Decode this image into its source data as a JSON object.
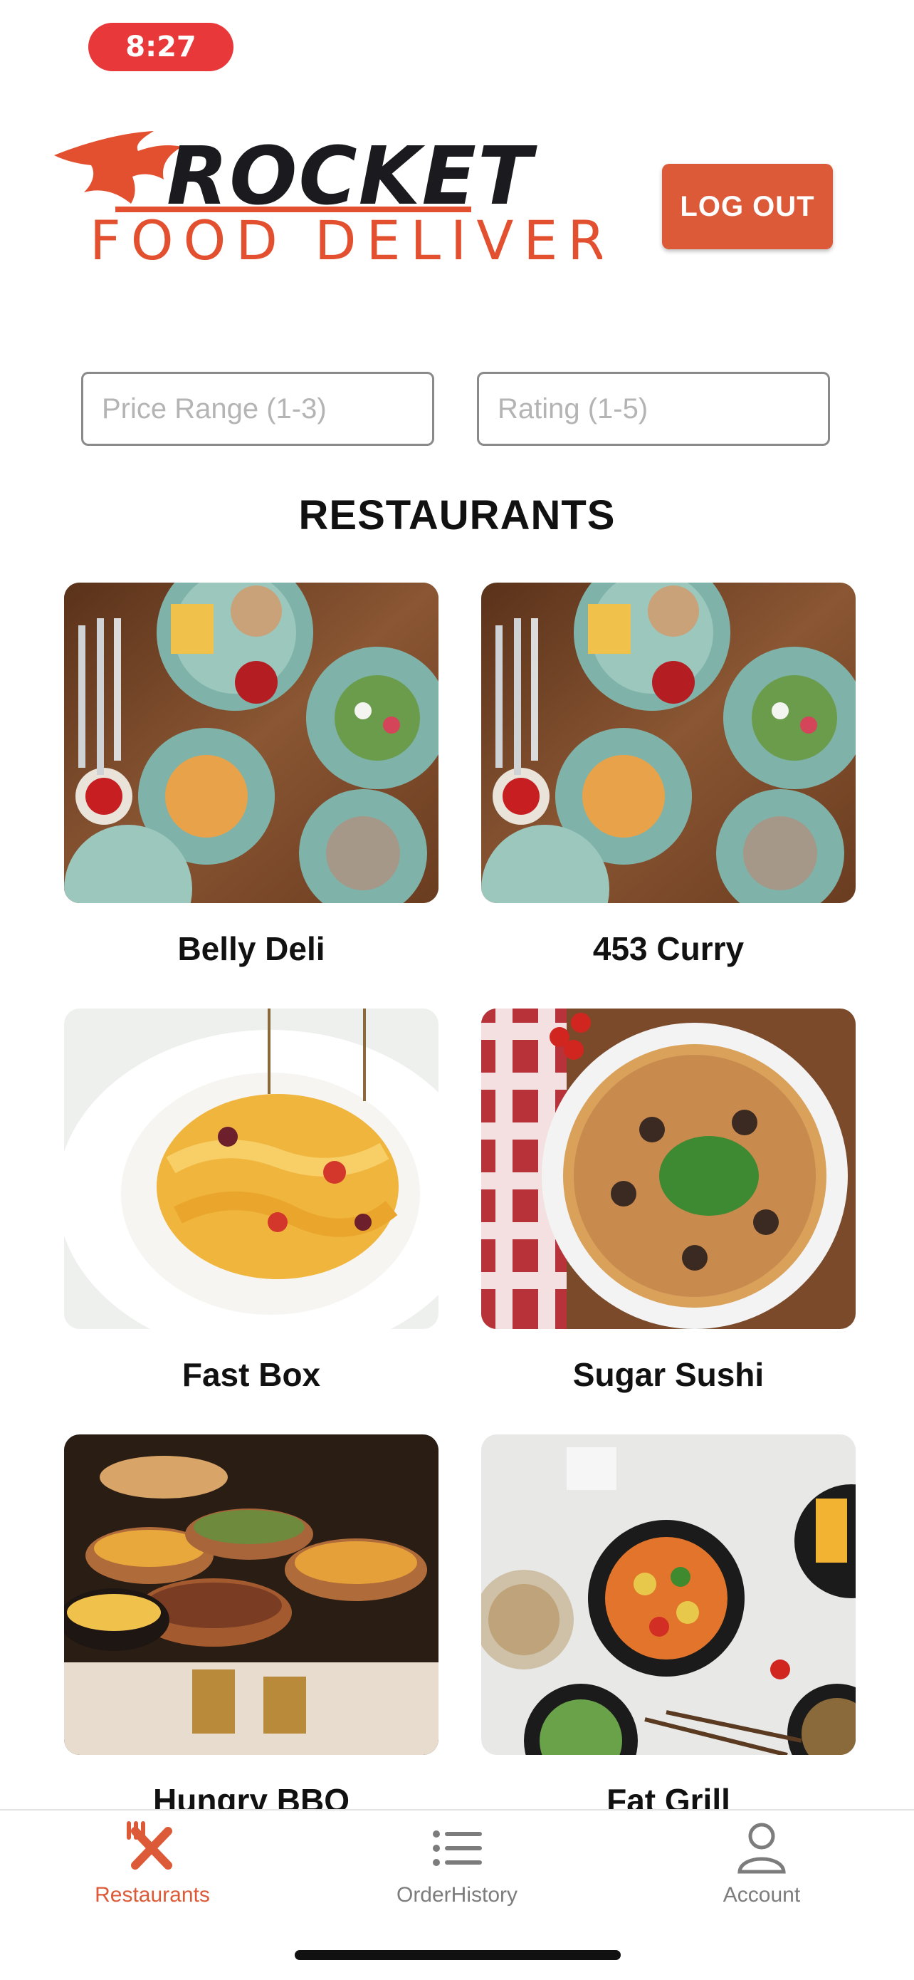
{
  "status_bar": {
    "time": "8:27"
  },
  "header": {
    "logo_word": "ROCKET",
    "logo_tagline": "FOOD DELIVERY",
    "logout_label": "LOG OUT",
    "brand_color": "#dd5a39"
  },
  "filters": {
    "price_placeholder": "Price Range (1-3)",
    "rating_placeholder": "Rating (1-5)"
  },
  "section_title": "RESTAURANTS",
  "restaurants": [
    {
      "name": "Belly Deli",
      "image": "table-spread-photo"
    },
    {
      "name": "453 Curry",
      "image": "table-spread-photo"
    },
    {
      "name": "Fast Box",
      "image": "pasta-photo"
    },
    {
      "name": "Sugar Sushi",
      "image": "pizza-photo"
    },
    {
      "name": "Hungry BBQ",
      "image": "indian-pots-photo"
    },
    {
      "name": "Fat Grill",
      "image": "asian-dishes-photo"
    }
  ],
  "tabbar": {
    "tabs": [
      {
        "label": "Restaurants",
        "icon": "fork-knife-icon",
        "active": true
      },
      {
        "label": "OrderHistory",
        "icon": "list-icon",
        "active": false
      },
      {
        "label": "Account",
        "icon": "person-icon",
        "active": false
      }
    ],
    "active_color": "#dd5a39",
    "inactive_color": "#7c7c7c"
  }
}
